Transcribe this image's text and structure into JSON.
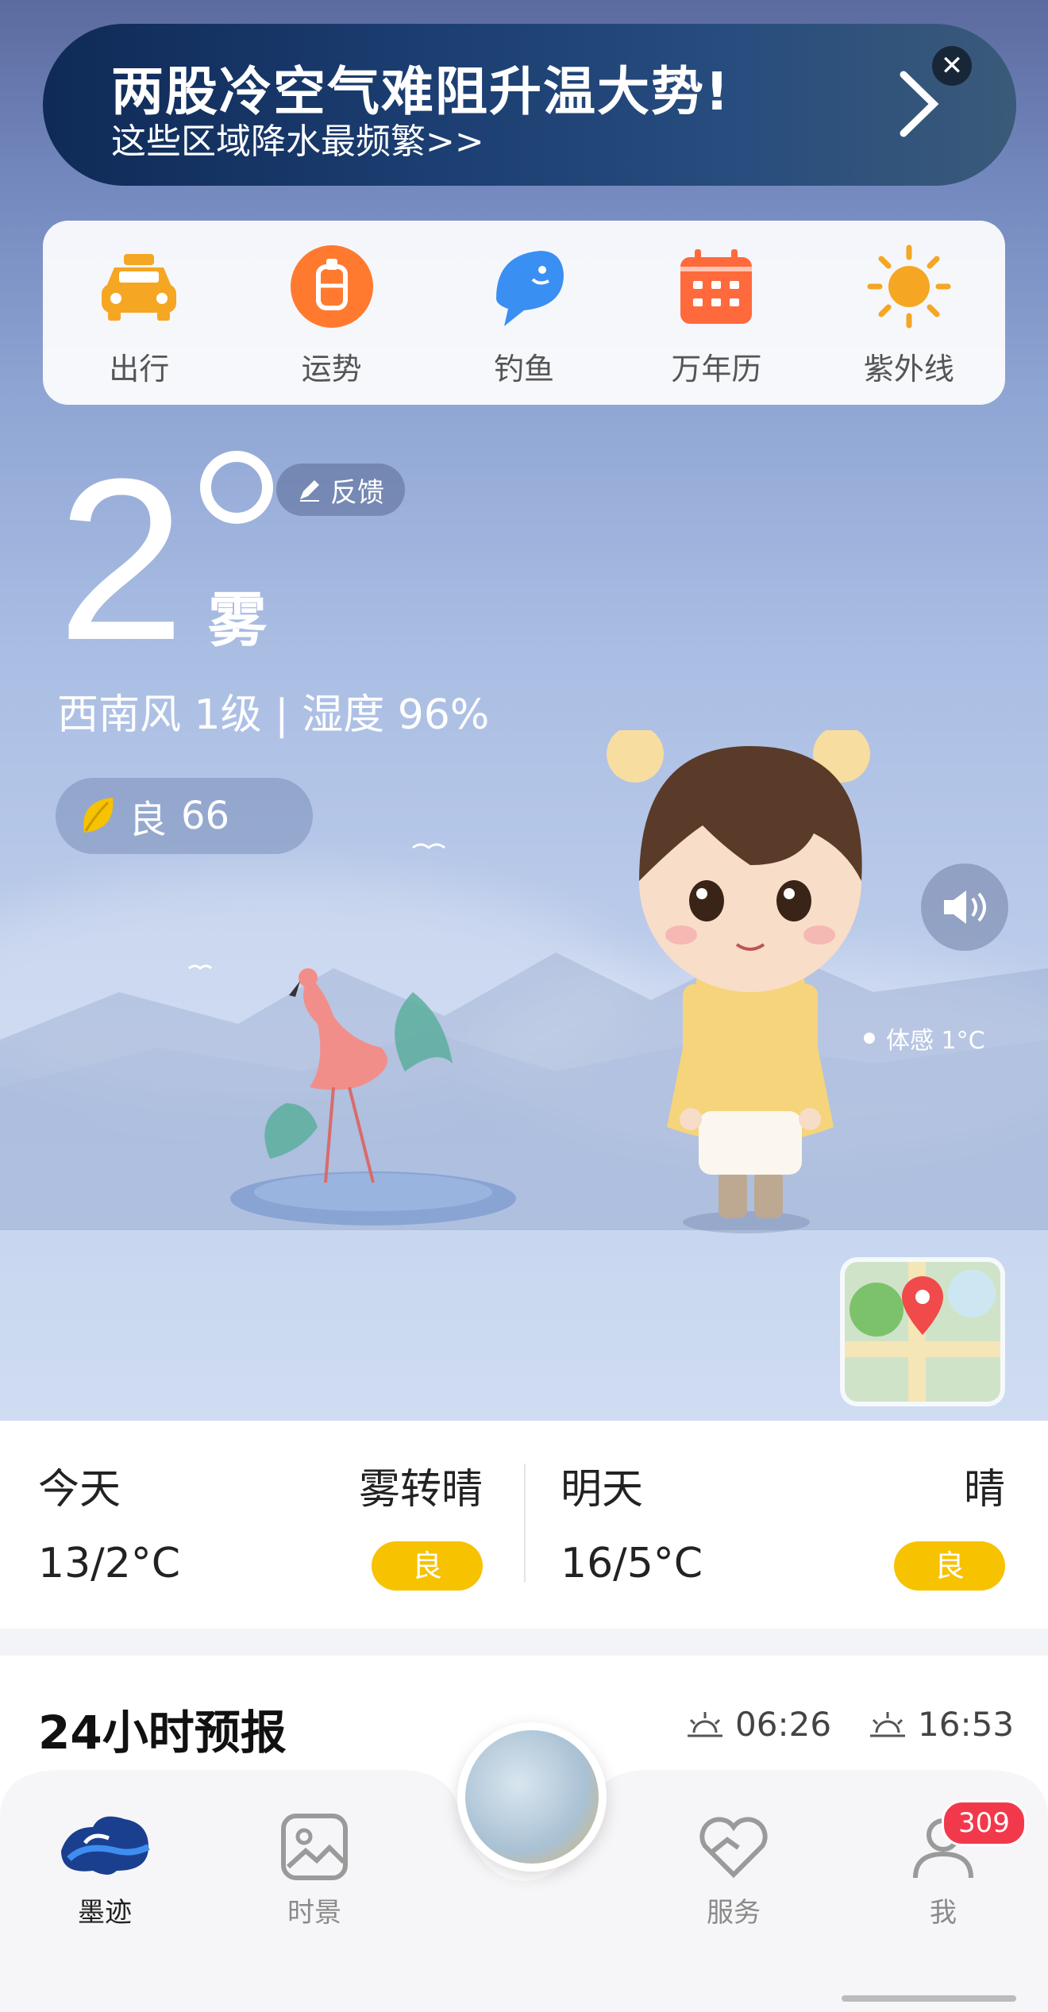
{
  "banner": {
    "title": "两股冷空气难阻升温大势!",
    "subtitle": "这些区域降水最频繁>>",
    "close": "✕"
  },
  "quick_items": [
    {
      "label": "出行",
      "icon": "taxi-icon",
      "color": "#f5a623"
    },
    {
      "label": "运势",
      "icon": "fortune-icon",
      "color": "#ff7a2f"
    },
    {
      "label": "钓鱼",
      "icon": "fish-icon",
      "color": "#3a8ff2"
    },
    {
      "label": "万年历",
      "icon": "calendar-icon",
      "color": "#ff6a3d"
    },
    {
      "label": "紫外线",
      "icon": "sun-icon",
      "color": "#f5a623"
    }
  ],
  "current": {
    "temperature": "2",
    "condition": "雾",
    "feedback": "反馈",
    "wind_humidity": "西南风 1级 | 湿度 96%",
    "aqi_label": "良",
    "aqi_value": "66",
    "feels_like": "体感 1°C"
  },
  "days": {
    "today": {
      "name": "今天",
      "condition": "雾转晴",
      "temp": "13/2°C",
      "aqi": "良"
    },
    "tomorrow": {
      "name": "明天",
      "condition": "晴",
      "temp": "16/5°C",
      "aqi": "良"
    }
  },
  "forecast": {
    "title": "24小时预报",
    "sunrise": "06:26",
    "sunset": "16:53"
  },
  "tabs": {
    "moji": "墨迹",
    "scenes": "时景",
    "services": "服务",
    "me": "我",
    "me_badge": "309"
  },
  "colors": {
    "accent_yellow": "#f7c200",
    "badge_red": "#f2394b"
  }
}
